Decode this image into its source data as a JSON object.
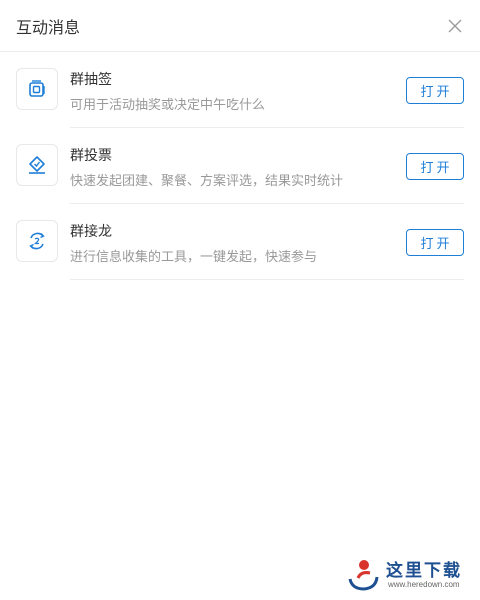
{
  "header": {
    "title": "互动消息"
  },
  "items": [
    {
      "name": "群抽签",
      "description": "可用于活动抽奖或决定中午吃什么",
      "button": "打开",
      "icon": "lottery-card-icon"
    },
    {
      "name": "群投票",
      "description": "快速发起团建、聚餐、方案评选，结果实时统计",
      "button": "打开",
      "icon": "vote-ballot-icon"
    },
    {
      "name": "群接龙",
      "description": "进行信息收集的工具，一键发起，快速参与",
      "button": "打开",
      "icon": "relay-chain-icon"
    }
  ],
  "watermark": {
    "text": "这里下载",
    "url": "www.heredown.com"
  },
  "colors": {
    "accent": "#1f7fd8",
    "text": "#333333",
    "muted": "#999999",
    "divider": "#ececec"
  }
}
